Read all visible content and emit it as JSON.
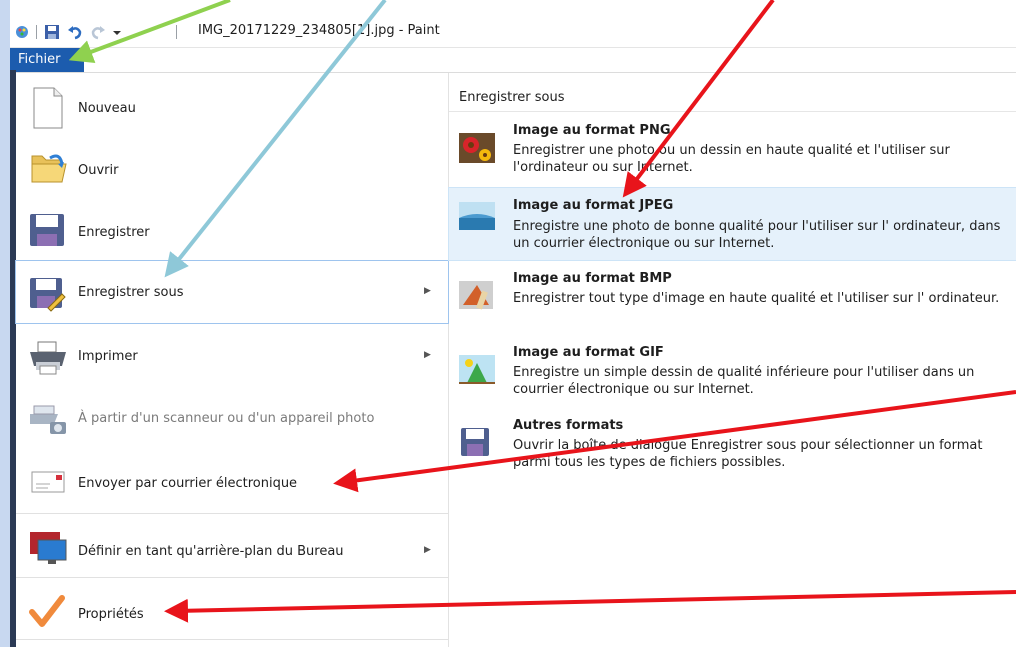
{
  "window": {
    "title": "IMG_20171229_234805[1].jpg - Paint"
  },
  "menubar": {
    "file_tab": "Fichier"
  },
  "file_menu": {
    "items": [
      {
        "label": "Nouveau",
        "icon": "new-document-icon",
        "submenu": false,
        "disabled": false
      },
      {
        "label": "Ouvrir",
        "icon": "open-folder-icon",
        "submenu": false,
        "disabled": false
      },
      {
        "label": "Enregistrer",
        "icon": "save-disk-icon",
        "submenu": false,
        "disabled": false
      },
      {
        "label": "Enregistrer sous",
        "icon": "save-as-icon",
        "submenu": true,
        "disabled": false,
        "selected": true
      },
      {
        "label": "Imprimer",
        "icon": "printer-icon",
        "submenu": true,
        "disabled": false
      },
      {
        "label": "À partir d'un scanneur ou d'un appareil photo",
        "icon": "scanner-icon",
        "submenu": false,
        "disabled": true
      },
      {
        "label": "Envoyer par courrier électronique",
        "icon": "email-icon",
        "submenu": false,
        "disabled": false
      },
      {
        "label": "Définir en tant qu'arrière-plan du Bureau",
        "icon": "desktop-background-icon",
        "submenu": true,
        "disabled": false
      },
      {
        "label": "Propriétés",
        "icon": "checkmark-icon",
        "submenu": false,
        "disabled": false
      }
    ]
  },
  "save_as_panel": {
    "heading": "Enregistrer sous",
    "formats": [
      {
        "title": "Image au format PNG",
        "description": "Enregistrer une photo ou un dessin en haute qualité et l'utiliser sur l'ordinateur ou sur Internet.",
        "icon": "png-flower-icon"
      },
      {
        "title": "Image au format JPEG",
        "description": "Enregistre une photo de bonne qualité pour l'utiliser sur l' ordinateur, dans un courrier électronique ou sur Internet.",
        "icon": "jpeg-landscape-icon",
        "highlighted": true
      },
      {
        "title": "Image au format BMP",
        "description": "Enregistrer tout type d'image en haute qualité et l'utiliser sur l' ordinateur.",
        "icon": "bmp-paint-icon"
      },
      {
        "title": "Image au format GIF",
        "description": "Enregistre un simple dessin de qualité inférieure pour l'utiliser dans un courrier électronique ou sur Internet.",
        "icon": "gif-shapes-icon"
      },
      {
        "title": "Autres formats",
        "description": "Ouvrir la boîte de dialogue Enregistrer sous pour sélectionner un format parmi tous les types de fichiers possibles.",
        "icon": "other-formats-icon"
      }
    ]
  },
  "annotation_colors": {
    "green": "#8fd14f",
    "blue": "#8ec8d8",
    "red": "#e8141b"
  }
}
